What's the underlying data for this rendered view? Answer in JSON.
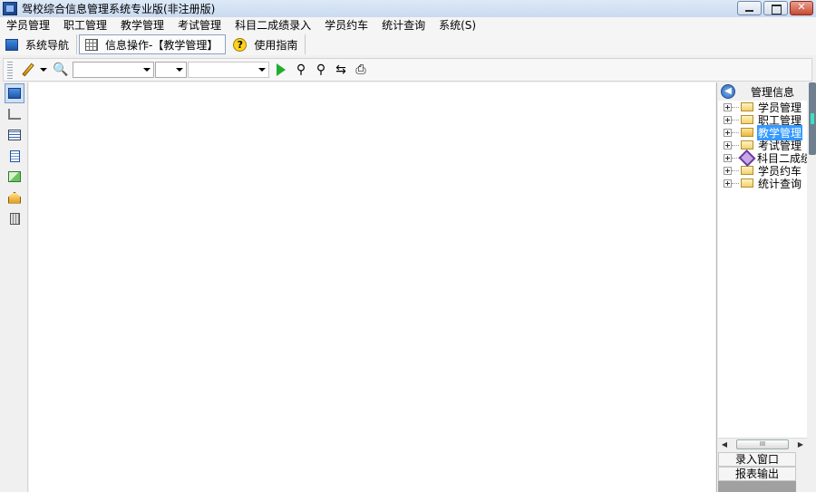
{
  "window": {
    "title": "驾校综合信息管理系统专业版(非注册版)"
  },
  "menu": {
    "items": [
      "学员管理",
      "职工管理",
      "教学管理",
      "考试管理",
      "科目二成绩录入",
      "学员约车",
      "统计查询",
      "系统(S)"
    ]
  },
  "tabs": {
    "nav": "系统导航",
    "info": "信息操作-【教学管理】",
    "guide": "使用指南"
  },
  "toolbar": {
    "combo1_value": "",
    "combo2_value": "",
    "combo3_value": ""
  },
  "right_panel": {
    "title": "管理信息",
    "tree": [
      {
        "label": "学员管理",
        "icon": "folder-icon"
      },
      {
        "label": "职工管理",
        "icon": "folder-icon"
      },
      {
        "label": "教学管理",
        "icon": "folder-open-icon",
        "selected": true
      },
      {
        "label": "考试管理",
        "icon": "folder-icon"
      },
      {
        "label": "科目二成绩录",
        "icon": "wrench-icon"
      },
      {
        "label": "学员约车",
        "icon": "folder-icon"
      },
      {
        "label": "统计查询",
        "icon": "folder-icon"
      }
    ],
    "scroll_thumb": "III",
    "buttons": {
      "entry": "录入窗口",
      "report": "报表输出"
    }
  }
}
